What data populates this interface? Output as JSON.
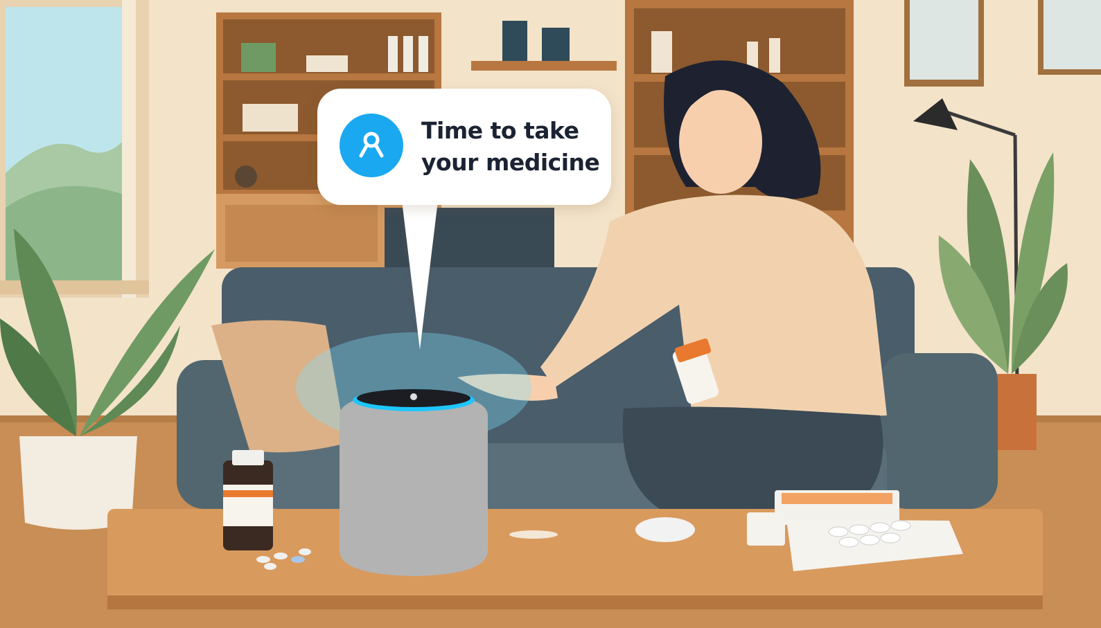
{
  "scene": {
    "colors": {
      "wall": "#f3e3c9",
      "floor": "#c88e55",
      "sofa": "#4a5d6b",
      "table": "#d99a5e",
      "speaker_ring": "#1ec6ff",
      "bubble_icon": "#1aa8f0",
      "sweater": "#f2d2ae"
    }
  },
  "reminder": {
    "line1": "Time to take",
    "line2": "your medicine",
    "icon": "ribbon-icon"
  }
}
